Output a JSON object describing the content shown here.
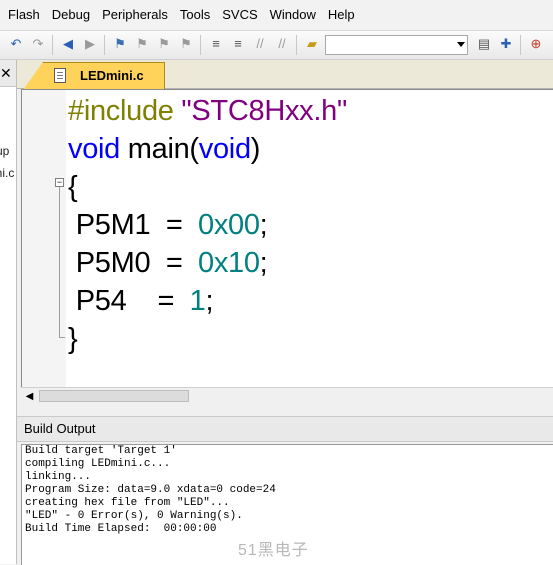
{
  "menu": [
    "Flash",
    "Debug",
    "Peripherals",
    "Tools",
    "SVCS",
    "Window",
    "Help"
  ],
  "toolbar": {
    "icons": [
      "undo-icon",
      "redo-icon",
      "back-icon",
      "forward-icon",
      "bookmark-icon",
      "bookmark-prev-icon",
      "bookmark-next-icon",
      "bookmark-clear-icon",
      "indent-icon",
      "unindent-icon",
      "comment-icon",
      "uncomment-icon",
      "open-file-icon",
      "configure-icon",
      "insert-icon",
      "inspect-icon"
    ],
    "combo_value": ""
  },
  "left_pane": {
    "fragments": [
      "up",
      "ini.c"
    ]
  },
  "editor": {
    "tab_label": "LEDmini.c",
    "lines": {
      "l1": {
        "a": "#include ",
        "b": "\"STC8Hxx.h\""
      },
      "l2": {
        "a": "void",
        "b": " main(",
        "c": "void",
        "d": ")"
      },
      "l3": {
        "a": "{"
      },
      "l4": {
        "a": " P5M1  =  ",
        "b": "0x00",
        "c": ";"
      },
      "l5": {
        "a": " P5M0  =  ",
        "b": "0x10",
        "c": ";"
      },
      "l6": {
        "a": " P54    =  ",
        "b": "1",
        "c": ";"
      },
      "l7": {
        "a": "}"
      }
    }
  },
  "build_output": {
    "title": "Build Output",
    "lines": [
      "Build target 'Target 1'",
      "compiling LEDmini.c...",
      "linking...",
      "Program Size: data=9.0 xdata=0 code=24",
      "creating hex file from \"LED\"...",
      "\"LED\" - 0 Error(s), 0 Warning(s).",
      "Build Time Elapsed:  00:00:00"
    ]
  },
  "watermark": "51黑电子"
}
